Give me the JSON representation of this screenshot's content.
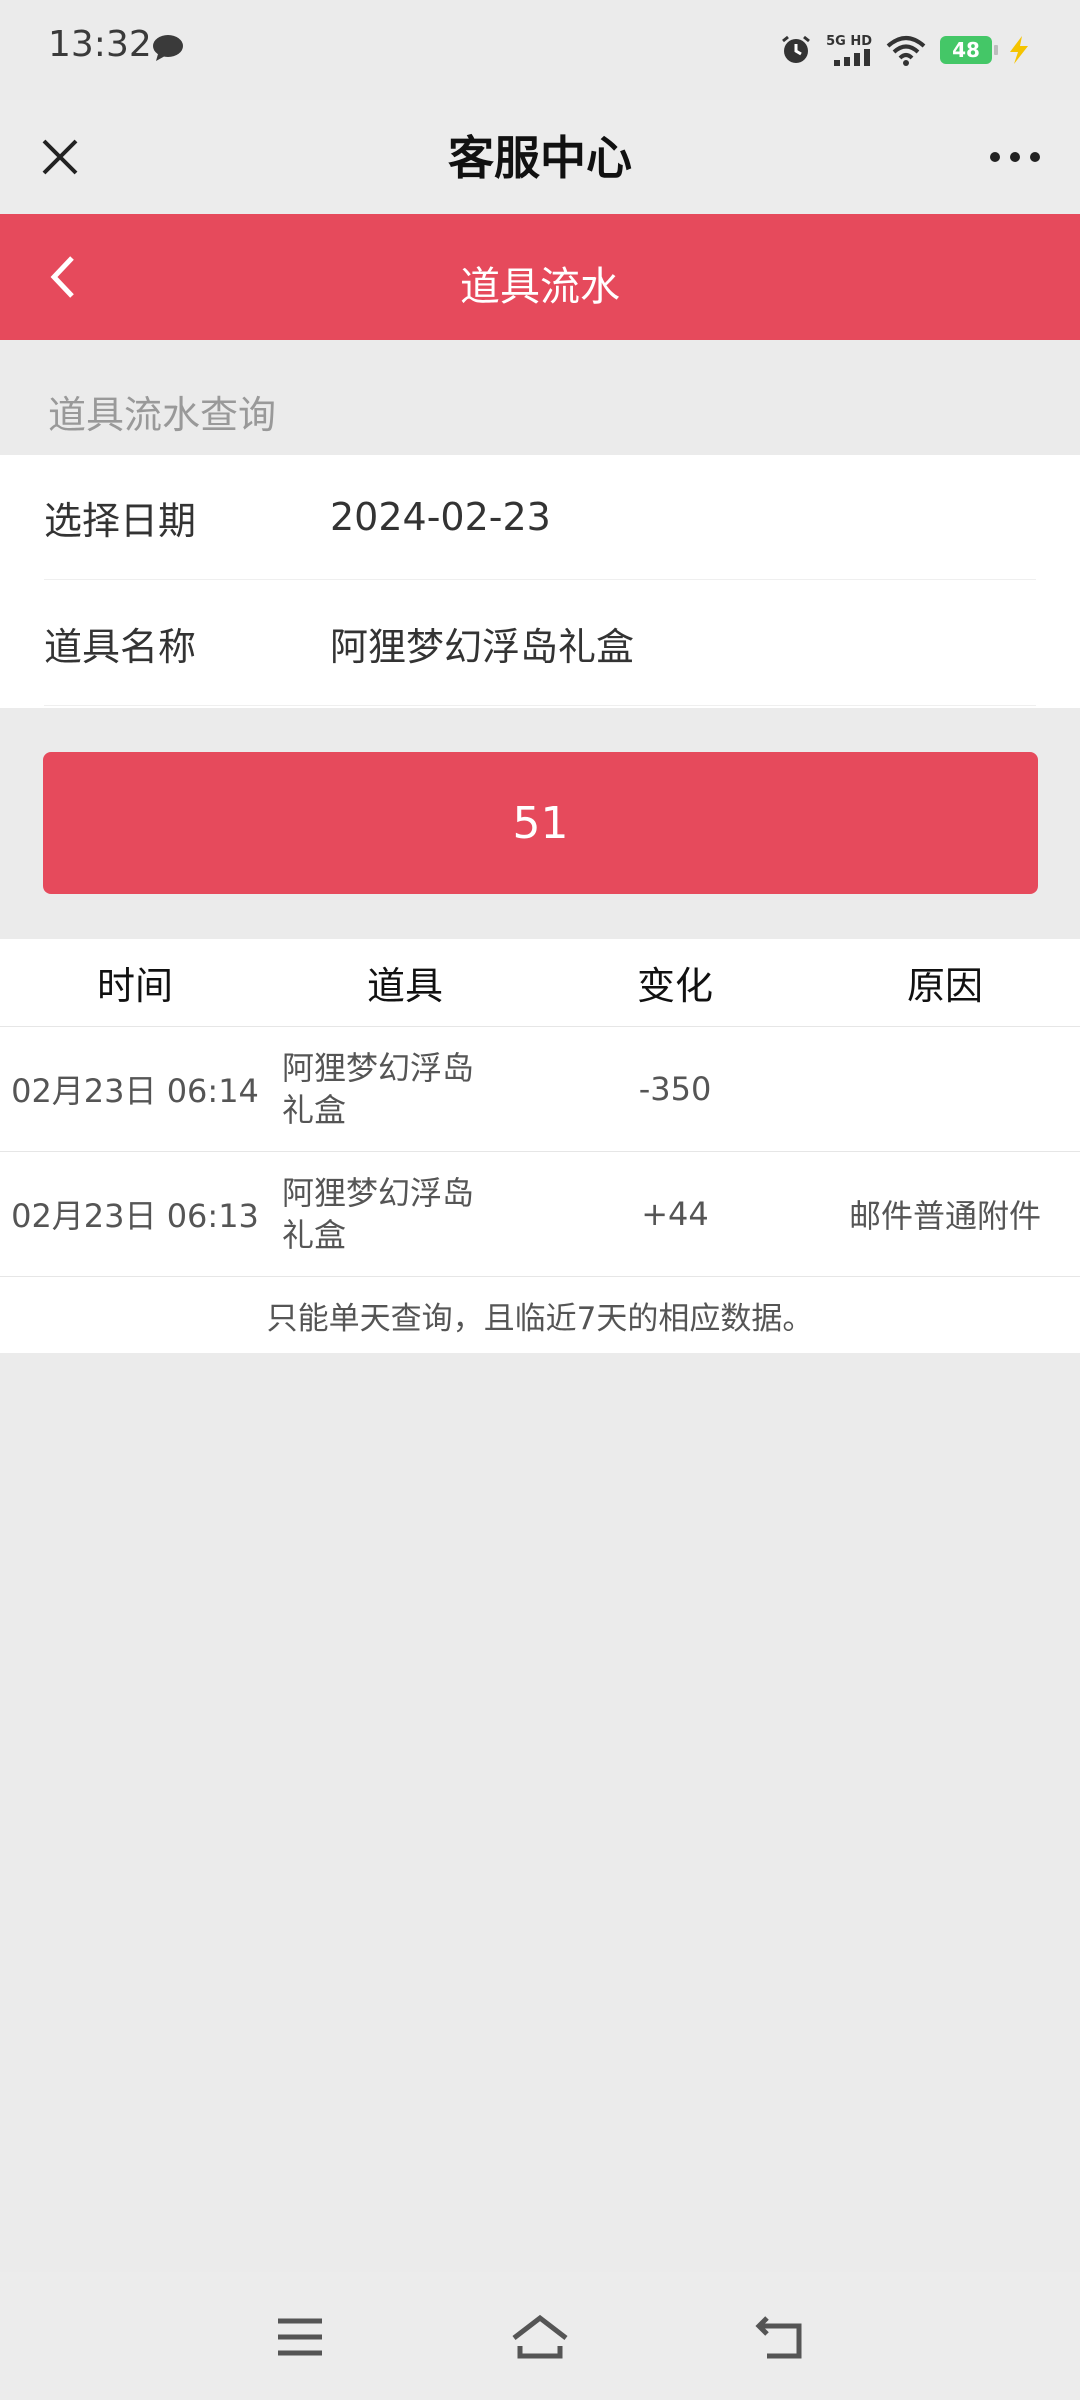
{
  "status_bar": {
    "time": "13:32",
    "network_label_top": "5G HD",
    "battery": "48",
    "icons": [
      "message-icon",
      "alarm-icon",
      "signal-icon",
      "wifi-icon",
      "battery-icon",
      "charging-icon"
    ]
  },
  "title_bar": {
    "title": "客服中心",
    "close_icon": "close-icon",
    "more_icon": "more-icon"
  },
  "header": {
    "title": "道具流水",
    "back_icon": "chevron-left-icon"
  },
  "section": {
    "label": "道具流水查询"
  },
  "form": {
    "date_label": "选择日期",
    "date_value": "2024-02-23",
    "item_label": "道具名称",
    "item_value": "阿狸梦幻浮岛礼盒"
  },
  "query_button": {
    "label": "51"
  },
  "table": {
    "columns": [
      "时间",
      "道具",
      "变化",
      "原因"
    ],
    "rows": [
      {
        "time": "02月23日 06:14",
        "item": "阿狸梦幻浮岛礼盒",
        "change": "-350",
        "reason": ""
      },
      {
        "time": "02月23日 06:13",
        "item": "阿狸梦幻浮岛礼盒",
        "change": "+44",
        "reason": "邮件普通附件"
      }
    ],
    "note": "只能单天查询，且临近7天的相应数据。"
  },
  "nav_bar": {
    "icons": [
      "menu-icon",
      "home-icon",
      "back-icon"
    ]
  },
  "colors": {
    "accent": "#e64a5c",
    "background": "#ebebeb",
    "battery": "#44c767",
    "charging": "#f5c400"
  }
}
